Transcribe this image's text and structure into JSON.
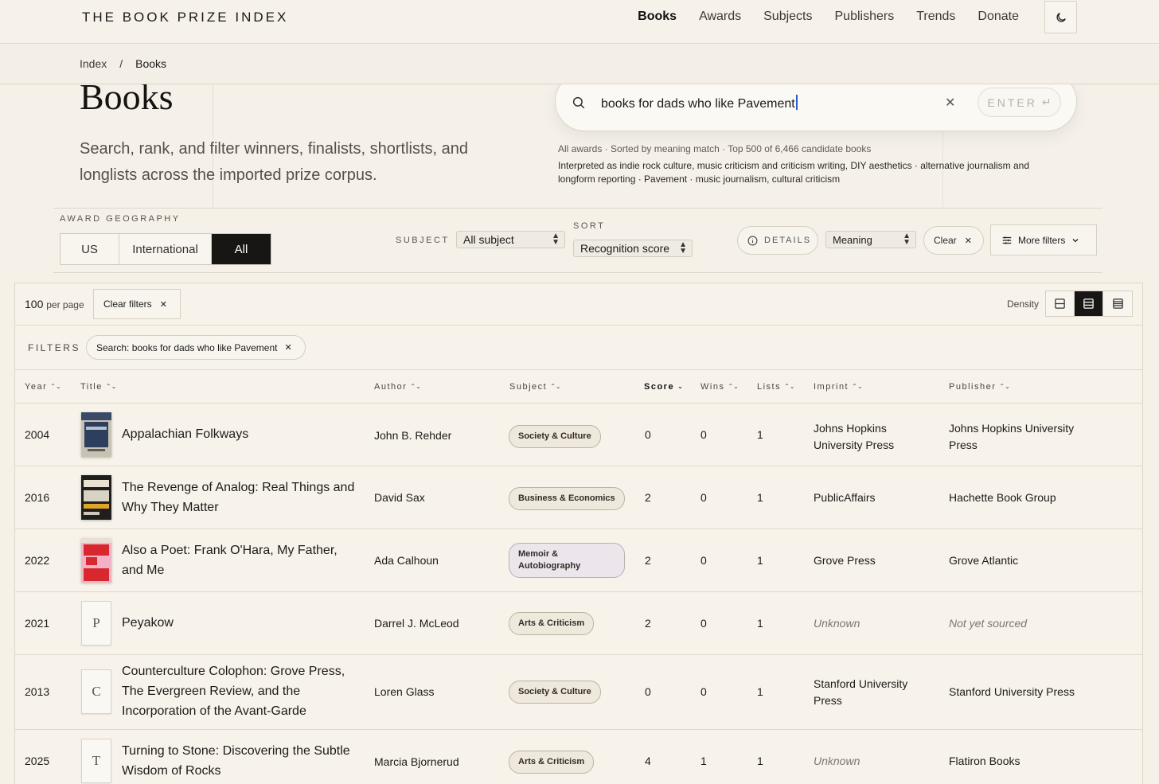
{
  "brand": "THE BOOK PRIZE INDEX",
  "nav": [
    "Books",
    "Awards",
    "Subjects",
    "Publishers",
    "Trends",
    "Donate"
  ],
  "nav_active": "Books",
  "breadcrumb": {
    "root": "Index",
    "sep": "/",
    "current": "Books"
  },
  "hero": {
    "title": "Books",
    "description": "Search, rank, and filter winners, finalists, shortlists, and longlists across the imported prize corpus."
  },
  "search": {
    "value": "books for dads who like Pavement",
    "enter_label": "ENTER",
    "meta": "All awards · Sorted by meaning match · Top 500 of 6,466 candidate books",
    "interpretation": "Interpreted as indie rock culture, music criticism and criticism writing, DIY aesthetics · alternative journalism and longform reporting · Pavement · music journalism, cultural criticism"
  },
  "controls": {
    "geography_label": "AWARD GEOGRAPHY",
    "geography_options": [
      "US",
      "International",
      "All"
    ],
    "geography_selected": "All",
    "subject_label": "SUBJECT",
    "subject_value": "All subject",
    "sort_label": "SORT",
    "sort_value": "Recognition score",
    "details_label": "DETAILS",
    "meaning_value": "Meaning",
    "clear_label": "Clear",
    "more_filters_label": "More filters"
  },
  "table_toolbar": {
    "per_page_value": "100",
    "per_page_suffix": "per page",
    "clear_filters_label": "Clear filters",
    "density_label": "Density",
    "filters_label": "FILTERS",
    "filter_chip": "Search: books for dads who like Pavement"
  },
  "columns": [
    "Year",
    "Title",
    "Author",
    "Subject",
    "Score",
    "Wins",
    "Lists",
    "Imprint",
    "Publisher"
  ],
  "sorted_column": "Score",
  "rows": [
    {
      "year": "2004",
      "title": "Appalachian Folkways",
      "author": "John B. Rehder",
      "subject": "Society & Culture",
      "score": "0",
      "wins": "0",
      "lists": "1",
      "imprint": "Johns Hopkins University Press",
      "publisher": "Johns Hopkins University Press",
      "cover": "image",
      "cover_colors": [
        "#2d3f5c",
        "#c9c2b4"
      ]
    },
    {
      "year": "2016",
      "title": "The Revenge of Analog: Real Things and Why They Matter",
      "author": "David Sax",
      "subject": "Business & Economics",
      "score": "2",
      "wins": "0",
      "lists": "1",
      "imprint": "PublicAffairs",
      "publisher": "Hachette Book Group",
      "cover": "image",
      "cover_colors": [
        "#1f1e1c",
        "#e0a526"
      ]
    },
    {
      "year": "2022",
      "title": "Also a Poet: Frank O'Hara, My Father, and Me",
      "author": "Ada Calhoun",
      "subject": "Memoir & Autobiography",
      "score": "2",
      "wins": "0",
      "lists": "1",
      "imprint": "Grove Press",
      "publisher": "Grove Atlantic",
      "cover": "image",
      "cover_colors": [
        "#d9272e",
        "#f1b3c5"
      ]
    },
    {
      "year": "2021",
      "title": "Peyakow",
      "author": "Darrel J. McLeod",
      "subject": "Arts & Criticism",
      "score": "2",
      "wins": "0",
      "lists": "1",
      "imprint": "Unknown",
      "publisher": "Not yet sourced",
      "cover": "P"
    },
    {
      "year": "2013",
      "title": "Counterculture Colophon: Grove Press, The Evergreen Review, and the Incorporation of the Avant-Garde",
      "author": "Loren Glass",
      "subject": "Society & Culture",
      "score": "0",
      "wins": "0",
      "lists": "1",
      "imprint": "Stanford University Press",
      "publisher": "Stanford University Press",
      "cover": "C"
    },
    {
      "year": "2025",
      "title": "Turning to Stone: Discovering the Subtle Wisdom of Rocks",
      "author": "Marcia Bjornerud",
      "subject": "Arts & Criticism",
      "score": "4",
      "wins": "1",
      "lists": "1",
      "imprint": "Unknown",
      "publisher": "Flatiron Books",
      "cover": "T"
    }
  ]
}
